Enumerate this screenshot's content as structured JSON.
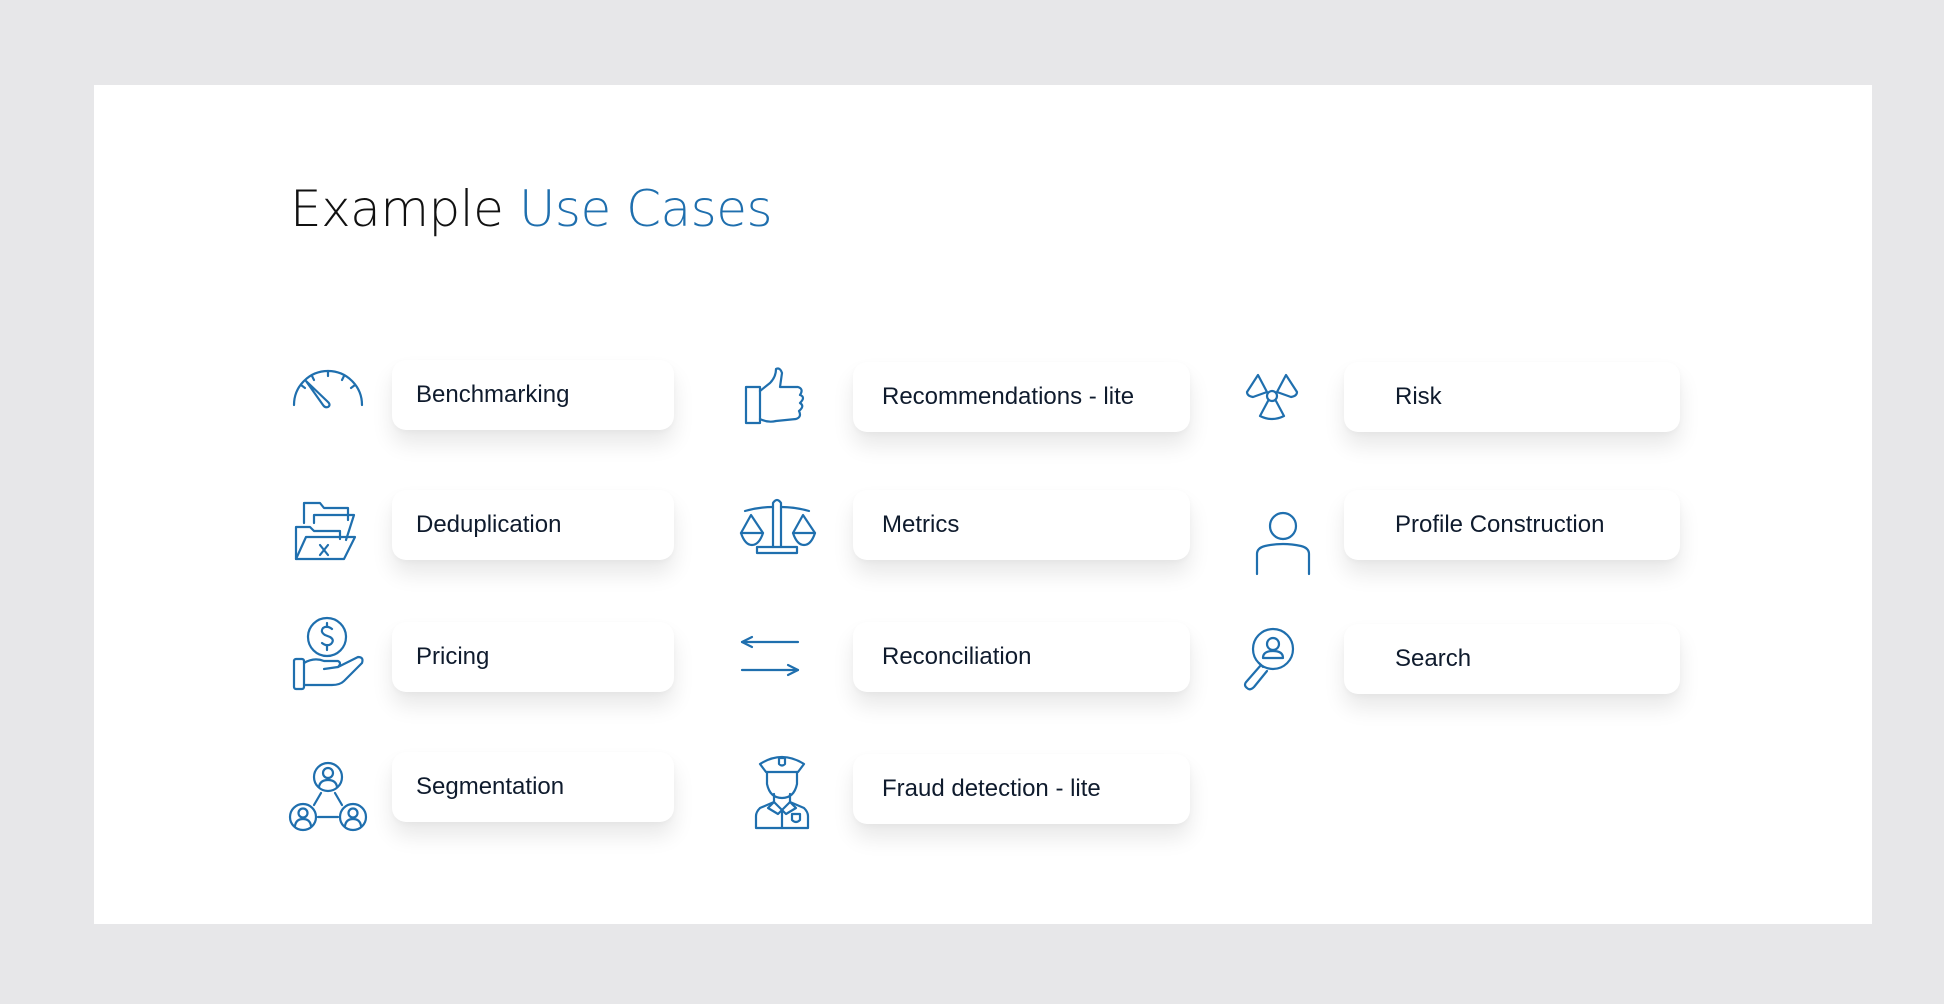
{
  "title": {
    "prefix": "Example",
    "accent": "Use Cases"
  },
  "accent_color": "#1f6fae",
  "columns": [
    {
      "items": [
        {
          "label": "Benchmarking",
          "icon": "speedometer-icon"
        },
        {
          "label": "Deduplication",
          "icon": "folders-x-icon"
        },
        {
          "label": "Pricing",
          "icon": "hand-dollar-icon"
        },
        {
          "label": "Segmentation",
          "icon": "user-network-icon"
        }
      ]
    },
    {
      "items": [
        {
          "label": "Recommendations - lite",
          "icon": "thumbs-up-icon"
        },
        {
          "label": "Metrics",
          "icon": "balance-scale-icon"
        },
        {
          "label": "Reconciliation",
          "icon": "swap-arrows-icon"
        },
        {
          "label": "Fraud detection - lite",
          "icon": "police-officer-icon"
        }
      ]
    },
    {
      "items": [
        {
          "label": "Risk",
          "icon": "radiation-icon"
        },
        {
          "label": "Profile Construction",
          "icon": "user-profile-icon"
        },
        {
          "label": "Search",
          "icon": "user-search-icon"
        }
      ]
    }
  ]
}
